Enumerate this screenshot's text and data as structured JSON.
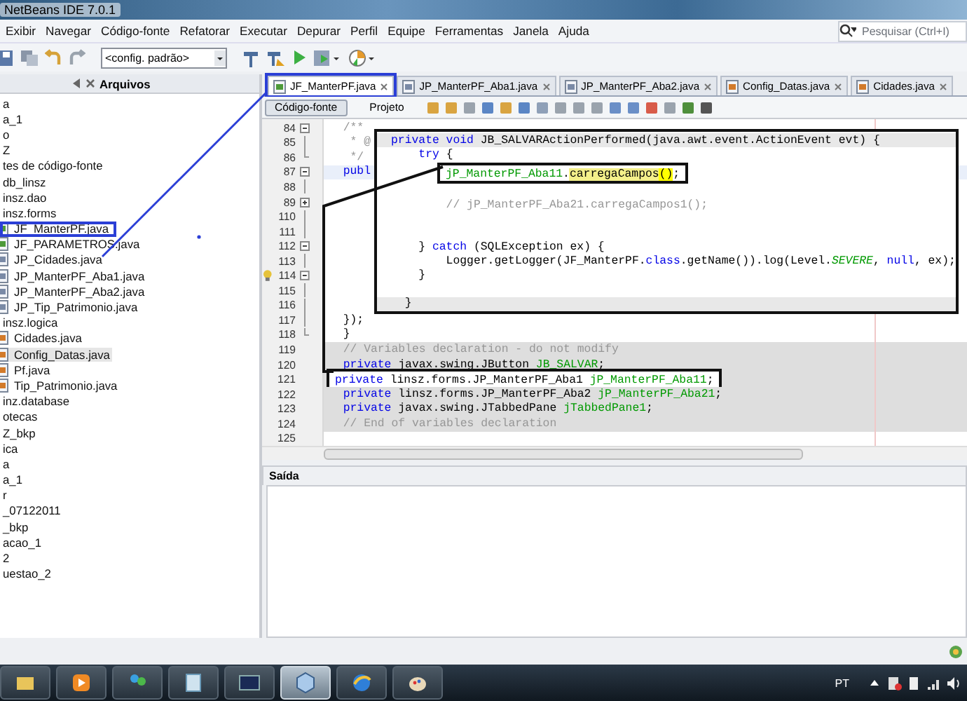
{
  "window": {
    "title": "NetBeans IDE 7.0.1"
  },
  "menu": [
    "Exibir",
    "Navegar",
    "Código-fonte",
    "Refatorar",
    "Executar",
    "Depurar",
    "Perfil",
    "Equipe",
    "Ferramentas",
    "Janela",
    "Ajuda"
  ],
  "search": {
    "placeholder": "Pesquisar (Ctrl+I)"
  },
  "toolbar": {
    "config": "<config. padrão>"
  },
  "files_panel": {
    "title": "Arquivos",
    "tree": [
      {
        "label": "a",
        "selected": false,
        "boxed": false
      },
      {
        "label": "a_1",
        "selected": false,
        "boxed": false
      },
      {
        "label": "o",
        "selected": false,
        "boxed": false
      },
      {
        "label": "Z",
        "selected": false,
        "boxed": false
      },
      {
        "label": "tes de código-fonte",
        "selected": false,
        "boxed": false
      },
      {
        "label": "db_linsz",
        "selected": false,
        "boxed": false
      },
      {
        "label": "insz.dao",
        "selected": false,
        "boxed": false
      },
      {
        "label": "insz.forms",
        "selected": false,
        "boxed": false,
        "children": [
          {
            "label": "JF_ManterPF.java",
            "kind": "form",
            "selected": false,
            "boxed": true
          },
          {
            "label": "JF_PARAMETROS.java",
            "kind": "form",
            "selected": false,
            "boxed": false
          },
          {
            "label": "JP_Cidades.java",
            "kind": "panel",
            "selected": false,
            "boxed": false
          },
          {
            "label": "JP_ManterPF_Aba1.java",
            "kind": "panel",
            "selected": false,
            "boxed": false
          },
          {
            "label": "JP_ManterPF_Aba2.java",
            "kind": "panel",
            "selected": false,
            "boxed": false
          },
          {
            "label": "JP_Tip_Patrimonio.java",
            "kind": "panel",
            "selected": false,
            "boxed": false
          }
        ]
      },
      {
        "label": "insz.logica",
        "selected": false,
        "boxed": false,
        "children": [
          {
            "label": "Cidades.java",
            "kind": "class",
            "selected": false,
            "boxed": false
          },
          {
            "label": "Config_Datas.java",
            "kind": "class",
            "selected": true,
            "boxed": false
          },
          {
            "label": "Pf.java",
            "kind": "class",
            "selected": false,
            "boxed": false
          },
          {
            "label": "Tip_Patrimonio.java",
            "kind": "class",
            "selected": false,
            "boxed": false
          }
        ]
      },
      {
        "label": "inz.database",
        "selected": false,
        "boxed": false
      },
      {
        "label": "otecas",
        "selected": false,
        "boxed": false
      },
      {
        "label": "Z_bkp",
        "selected": false,
        "boxed": false
      },
      {
        "label": "ica",
        "selected": false,
        "boxed": false
      },
      {
        "label": "a",
        "selected": false,
        "boxed": false
      },
      {
        "label": "a_1",
        "selected": false,
        "boxed": false
      },
      {
        "label": "r",
        "selected": false,
        "boxed": false
      },
      {
        "label": "_07122011",
        "selected": false,
        "boxed": false
      },
      {
        "label": "_bkp",
        "selected": false,
        "boxed": false
      },
      {
        "label": "acao_1",
        "selected": false,
        "boxed": false
      },
      {
        "label": "2",
        "selected": false,
        "boxed": false
      },
      {
        "label": "uestao_2",
        "selected": false,
        "boxed": false
      }
    ]
  },
  "editor_tabs": [
    {
      "label": "JF_ManterPF.java",
      "kind": "form",
      "selected": true,
      "boxed": true
    },
    {
      "label": "JP_ManterPF_Aba1.java",
      "kind": "panel",
      "selected": false,
      "boxed": false
    },
    {
      "label": "JP_ManterPF_Aba2.java",
      "kind": "panel",
      "selected": false,
      "boxed": false
    },
    {
      "label": "Config_Datas.java",
      "kind": "class",
      "selected": false,
      "boxed": false
    },
    {
      "label": "Cidades.java",
      "kind": "class",
      "selected": false,
      "boxed": false
    }
  ],
  "view_buttons": [
    {
      "label": "Código-fonte",
      "selected": true
    },
    {
      "label": "Projeto",
      "selected": false
    }
  ],
  "code_lines": [
    {
      "n": "84",
      "kind": "fold-open",
      "hint": false,
      "guarded": false,
      "current": false,
      "boxed": false,
      "tokens": [
        {
          "kind": "comment",
          "text": "  /**"
        }
      ]
    },
    {
      "n": "85",
      "kind": "fold-line",
      "hint": false,
      "guarded": false,
      "current": false,
      "boxed": false,
      "tokens": [
        {
          "kind": "comment",
          "text": "   * @"
        }
      ]
    },
    {
      "n": "86",
      "kind": "fold-end",
      "hint": false,
      "guarded": false,
      "current": false,
      "boxed": false,
      "tokens": [
        {
          "kind": "comment",
          "text": "   */"
        }
      ]
    },
    {
      "n": "87",
      "kind": "fold-open",
      "hint": false,
      "guarded": false,
      "current": true,
      "boxed": false,
      "tokens": [
        {
          "kind": "keyword",
          "text": "  publ"
        }
      ]
    },
    {
      "n": "88",
      "kind": "fold-line",
      "hint": false,
      "guarded": false,
      "current": false,
      "boxed": false
    },
    {
      "n": "89",
      "kind": "fold-closed",
      "hint": false,
      "guarded": false,
      "current": false,
      "boxed": false
    },
    {
      "n": "110",
      "kind": "fold-line",
      "hint": false,
      "guarded": false,
      "current": false,
      "boxed": false
    },
    {
      "n": "111",
      "kind": "fold-line",
      "hint": false,
      "guarded": false,
      "current": false,
      "boxed": false
    },
    {
      "n": "112",
      "kind": "fold-open",
      "hint": false,
      "guarded": false,
      "current": false,
      "boxed": false
    },
    {
      "n": "113",
      "kind": "fold-line",
      "hint": false,
      "guarded": false,
      "current": false,
      "boxed": false
    },
    {
      "n": "114",
      "kind": "fold-open",
      "hint": true,
      "guarded": false,
      "current": false,
      "boxed": false
    },
    {
      "n": "115",
      "kind": "fold-line",
      "hint": false,
      "guarded": false,
      "current": false,
      "boxed": false
    },
    {
      "n": "116",
      "kind": "fold-line",
      "hint": false,
      "guarded": false,
      "current": false,
      "boxed": false
    },
    {
      "n": "117",
      "kind": "fold-line",
      "hint": false,
      "guarded": false,
      "current": false,
      "boxed": false,
      "tokens": [
        {
          "kind": "plain",
          "text": "  });"
        }
      ]
    },
    {
      "n": "118",
      "kind": "fold-end",
      "hint": false,
      "guarded": false,
      "current": false,
      "boxed": false,
      "tokens": [
        {
          "kind": "plain",
          "text": "  }"
        }
      ]
    },
    {
      "n": "119",
      "kind": "plain",
      "hint": false,
      "guarded": true,
      "current": false,
      "boxed": false,
      "tokens": [
        {
          "kind": "comment",
          "text": "  // Variables declaration - do not modify"
        }
      ]
    },
    {
      "n": "120",
      "kind": "plain",
      "hint": false,
      "guarded": true,
      "current": false,
      "boxed": false,
      "tokens": [
        {
          "kind": "keyword",
          "text": "  private"
        },
        {
          "kind": "plain",
          "text": " javax.swing.JButton "
        },
        {
          "kind": "field",
          "text": "JB_SALVAR"
        },
        {
          "kind": "plain",
          "text": ";"
        }
      ]
    },
    {
      "n": "121",
      "kind": "plain",
      "hint": false,
      "guarded": true,
      "current": false,
      "boxed": true,
      "tokens": [
        {
          "kind": "keyword",
          "text": "private"
        },
        {
          "kind": "plain",
          "text": " linsz.forms.JP_ManterPF_Aba1 "
        },
        {
          "kind": "field",
          "text": "jP_ManterPF_Aba11"
        },
        {
          "kind": "plain",
          "text": ";"
        }
      ]
    },
    {
      "n": "122",
      "kind": "plain",
      "hint": false,
      "guarded": true,
      "current": false,
      "boxed": false,
      "tokens": [
        {
          "kind": "keyword",
          "text": "  private"
        },
        {
          "kind": "plain",
          "text": " linsz.forms.JP_ManterPF_Aba2 "
        },
        {
          "kind": "field",
          "text": "jP_ManterPF_Aba21"
        },
        {
          "kind": "plain",
          "text": ";"
        }
      ]
    },
    {
      "n": "123",
      "kind": "plain",
      "hint": false,
      "guarded": true,
      "current": false,
      "boxed": false,
      "tokens": [
        {
          "kind": "keyword",
          "text": "  private"
        },
        {
          "kind": "plain",
          "text": " javax.swing.JTabbedPane "
        },
        {
          "kind": "field",
          "text": "jTabbedPane1"
        },
        {
          "kind": "plain",
          "text": ";"
        }
      ]
    },
    {
      "n": "124",
      "kind": "plain",
      "hint": false,
      "guarded": true,
      "current": false,
      "boxed": false,
      "tokens": [
        {
          "kind": "comment",
          "text": "  // End of variables declaration"
        }
      ]
    },
    {
      "n": "125",
      "kind": "plain",
      "hint": false,
      "guarded": false,
      "current": false,
      "boxed": false
    }
  ],
  "zoom_callout": {
    "lines": [
      {
        "guarded": true,
        "boxed": false,
        "tokens": [
          {
            "kind": "keyword",
            "text": "private void"
          },
          {
            "kind": "plain",
            "text": " JB_SALVARActionPerformed(java.awt.event.ActionEvent evt) {"
          }
        ]
      },
      {
        "guarded": false,
        "boxed": false,
        "tokens": [
          {
            "kind": "keyword",
            "text": "    try"
          },
          {
            "kind": "plain",
            "text": " {"
          }
        ]
      },
      {
        "guarded": false,
        "boxed": true,
        "tokens": [
          {
            "kind": "field",
            "text": "jP_ManterPF_Aba11"
          },
          {
            "kind": "plain",
            "text": "."
          },
          {
            "kind": "match",
            "text": "carregaCampos"
          },
          {
            "kind": "match-strong",
            "text": "()"
          },
          {
            "kind": "plain",
            "text": ";"
          }
        ]
      },
      {
        "guarded": false,
        "boxed": false
      },
      {
        "guarded": false,
        "boxed": false,
        "tokens": [
          {
            "kind": "comment",
            "text": "        // jP_ManterPF_Aba21.carregaCampos1();"
          }
        ]
      },
      {
        "guarded": false,
        "boxed": false
      },
      {
        "guarded": false,
        "boxed": false
      },
      {
        "guarded": false,
        "boxed": false,
        "tokens": [
          {
            "kind": "plain",
            "text": "    } "
          },
          {
            "kind": "keyword",
            "text": "catch"
          },
          {
            "kind": "plain",
            "text": " (SQLException ex) {"
          }
        ]
      },
      {
        "guarded": false,
        "boxed": false,
        "tokens": [
          {
            "kind": "plain",
            "text": "        Logger.getLogger(JF_ManterPF."
          },
          {
            "kind": "keyword",
            "text": "class"
          },
          {
            "kind": "plain",
            "text": ".getName()).log(Level."
          },
          {
            "kind": "static",
            "text": "SEVERE"
          },
          {
            "kind": "plain",
            "text": ", "
          },
          {
            "kind": "keyword",
            "text": "null"
          },
          {
            "kind": "plain",
            "text": ", ex);"
          }
        ]
      },
      {
        "guarded": false,
        "boxed": false,
        "tokens": [
          {
            "kind": "plain",
            "text": "    }"
          }
        ]
      },
      {
        "guarded": false,
        "boxed": false
      },
      {
        "guarded": true,
        "boxed": false,
        "tokens": [
          {
            "kind": "plain",
            "text": "  }"
          }
        ]
      }
    ]
  },
  "output_panel": {
    "title": "Saída"
  },
  "taskbar": [
    {
      "kind": "folder",
      "selected": false
    },
    {
      "kind": "media",
      "selected": false
    },
    {
      "kind": "people",
      "selected": false
    },
    {
      "kind": "notepad",
      "selected": false
    },
    {
      "kind": "terminal",
      "selected": false
    },
    {
      "kind": "cube",
      "selected": true
    },
    {
      "kind": "browser",
      "selected": false
    },
    {
      "kind": "paint",
      "selected": false
    }
  ],
  "tray": {
    "language": "PT"
  }
}
